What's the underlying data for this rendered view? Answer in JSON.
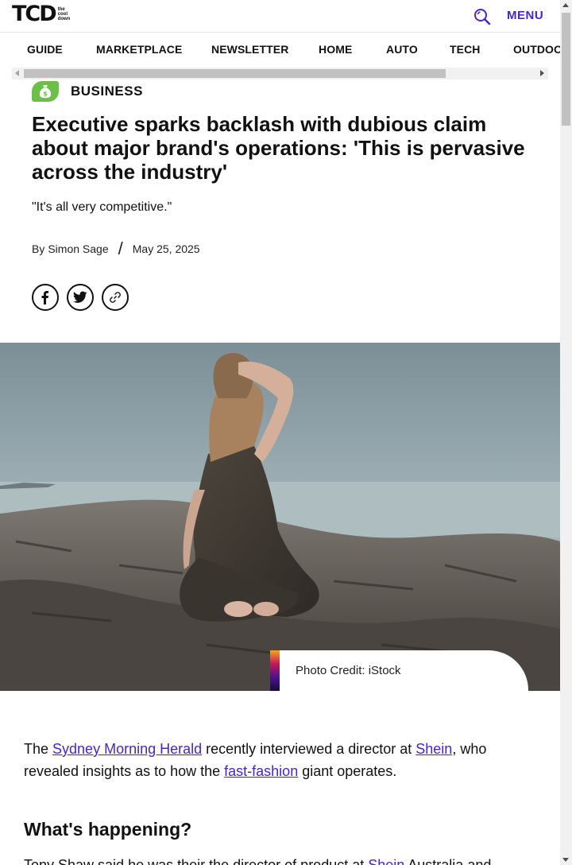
{
  "header": {
    "logo_text": "TCD",
    "logo_sub": [
      "the",
      "cool",
      "down"
    ],
    "menu_label": "MENU"
  },
  "nav": {
    "items": [
      "GUIDE",
      "MARKETPLACE",
      "NEWSLETTER",
      "HOME",
      "AUTO",
      "TECH",
      "OUTDOORS"
    ]
  },
  "article": {
    "category": "BUSINESS",
    "headline": "Executive sparks backlash with dubious claim about major brand's operations: 'This is pervasive across the industry'",
    "dek": "\"It's all very competitive.\"",
    "byline_prefix": "By",
    "author": "Simon Sage",
    "separator": "/",
    "date": "May 25, 2025",
    "photo_credit": "Photo Credit: iStock",
    "p1": {
      "t1": "The ",
      "link1": "Sydney Morning Herald",
      "t2": " recently interviewed a director at ",
      "link2": "Shein",
      "t3": ", who revealed insights as to how the ",
      "link3": "fast-fashion",
      "t4": " giant operates."
    },
    "h2": "What's happening?",
    "p2": {
      "t1": "Tony Shaw said he was their the director of product at ",
      "link1": "Shein",
      "t2": " Australia and"
    }
  },
  "colors": {
    "accent": "#4a22c9",
    "category_green": "#6cc04a"
  }
}
